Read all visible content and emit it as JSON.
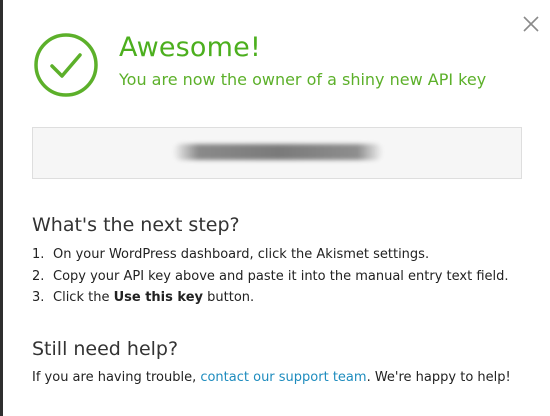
{
  "success": {
    "title": "Awesome!",
    "subtitle": "You are now the owner of a shiny new API key",
    "check_color": "#5cb02a"
  },
  "api_key": {
    "value_obscured": true
  },
  "next_step": {
    "heading": "What's the next step?",
    "steps": [
      {
        "number": "1.",
        "text": "On your WordPress dashboard, click the Akismet settings."
      },
      {
        "number": "2.",
        "text": "Copy your API key above and paste it into the manual entry text field."
      },
      {
        "number": "3.",
        "text_before": "Click the ",
        "bold": "Use this key",
        "text_after": " button."
      }
    ]
  },
  "help": {
    "heading": "Still need help?",
    "text_before": "If you are having trouble, ",
    "link_text": "contact our support team",
    "text_after": ". We're happy to help!",
    "link_color": "#1e8cbe"
  },
  "icons": {
    "close": "close-icon",
    "check": "checkmark-circle-icon"
  }
}
